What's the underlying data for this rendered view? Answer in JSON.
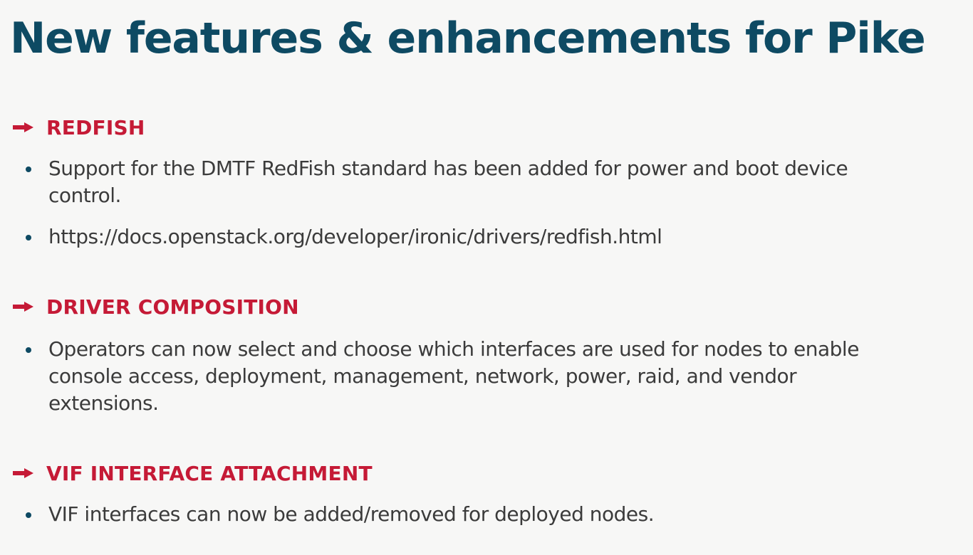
{
  "title": "New features & enhancements for Pike",
  "sections": [
    {
      "heading": "REDFISH",
      "bullets": [
        "Support for the DMTF RedFish standard has been added for power and boot device control.",
        "https://docs.openstack.org/developer/ironic/drivers/redfish.html"
      ]
    },
    {
      "heading": "DRIVER COMPOSITION",
      "bullets": [
        "Operators can now select and choose which interfaces are used for nodes to enable console access, deployment, management, network, power, raid, and vendor extensions."
      ]
    },
    {
      "heading": "VIF INTERFACE ATTACHMENT",
      "bullets": [
        "VIF interfaces can now be added/removed for deployed nodes."
      ]
    }
  ],
  "icons": {
    "section_marker": "right-arrow-icon",
    "bullet_marker": "bullet-dot-icon"
  },
  "colors": {
    "title": "#0e4a63",
    "heading": "#c51a36",
    "bullet_text": "#3b3b3b",
    "bullet_dot": "#0e4a63",
    "background": "#f7f7f6"
  }
}
